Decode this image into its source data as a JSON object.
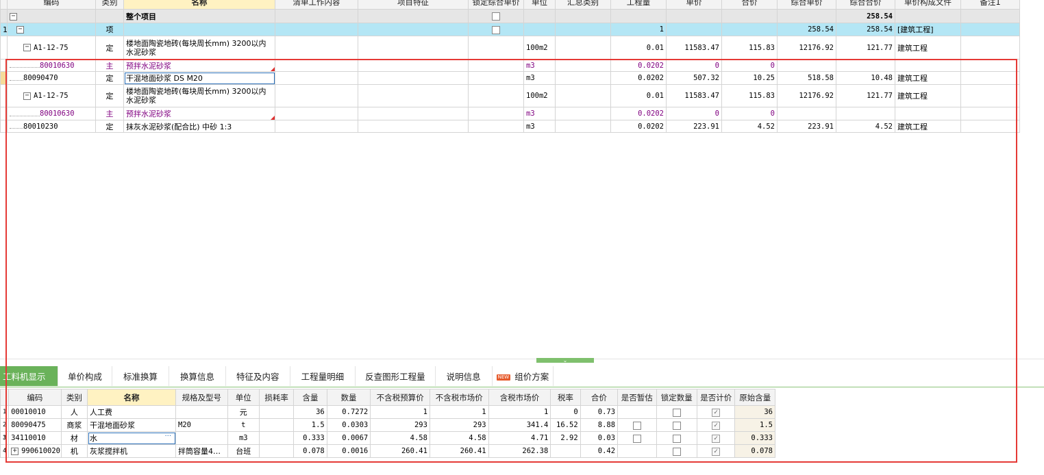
{
  "upper": {
    "headers": [
      "编码",
      "类别",
      "名称",
      "清单工作内容",
      "项目特征",
      "锁定综合单价",
      "单位",
      "汇总类别",
      "工程量",
      "单价",
      "合价",
      "综合单价",
      "综合合价",
      "单价构成文件",
      "备注1"
    ],
    "rows": [
      {
        "rownum": "",
        "code": "",
        "type": "",
        "name": "整个项目",
        "unit": "",
        "qty": "",
        "price": "",
        "amount": "",
        "comp_price": "",
        "comp_total": "258.54",
        "file": ""
      },
      {
        "rownum": "1",
        "code": "",
        "type": "项",
        "name": "",
        "unit": "",
        "qty": "1",
        "price": "",
        "amount": "",
        "comp_price": "258.54",
        "comp_total": "258.54",
        "file": "[建筑工程]"
      },
      {
        "rownum": "",
        "code": "A1-12-75",
        "type": "定",
        "name": "楼地面陶瓷地砖(每块周长mm) 3200以内水泥砂浆",
        "unit": "100m2",
        "qty": "0.01",
        "price": "11583.47",
        "amount": "115.83",
        "comp_price": "12176.92",
        "comp_total": "121.77",
        "file": "建筑工程"
      },
      {
        "rownum": "",
        "code": "80010630",
        "type": "主",
        "name": "预拌水泥砂浆",
        "unit": "m3",
        "qty": "0.0202",
        "price": "0",
        "amount": "0",
        "comp_price": "",
        "comp_total": "",
        "file": ""
      },
      {
        "rownum": "",
        "code": "80090470",
        "type": "定",
        "name": "干混地面砂浆 DS M20",
        "unit": "m3",
        "qty": "0.0202",
        "price": "507.32",
        "amount": "10.25",
        "comp_price": "518.58",
        "comp_total": "10.48",
        "file": "建筑工程"
      },
      {
        "rownum": "",
        "code": "A1-12-75",
        "type": "定",
        "name": "楼地面陶瓷地砖(每块周长mm) 3200以内水泥砂浆",
        "unit": "100m2",
        "qty": "0.01",
        "price": "11583.47",
        "amount": "115.83",
        "comp_price": "12176.92",
        "comp_total": "121.77",
        "file": "建筑工程"
      },
      {
        "rownum": "",
        "code": "80010630",
        "type": "主",
        "name": "预拌水泥砂浆",
        "unit": "m3",
        "qty": "0.0202",
        "price": "0",
        "amount": "0",
        "comp_price": "",
        "comp_total": "",
        "file": ""
      },
      {
        "rownum": "",
        "code": "80010230",
        "type": "定",
        "name": "抹灰水泥砂浆(配合比) 中砂 1:3",
        "unit": "m3",
        "qty": "0.0202",
        "price": "223.91",
        "amount": "4.52",
        "comp_price": "223.91",
        "comp_total": "4.52",
        "file": "建筑工程"
      }
    ]
  },
  "tabs": [
    "工料机显示",
    "单价构成",
    "标准换算",
    "换算信息",
    "特征及内容",
    "工程量明细",
    "反查图形工程量",
    "说明信息",
    "组价方案"
  ],
  "new_badge": "NEW",
  "lower": {
    "headers": [
      "编码",
      "类别",
      "名称",
      "规格及型号",
      "单位",
      "损耗率",
      "含量",
      "数量",
      "不含税预算价",
      "不含税市场价",
      "含税市场价",
      "税率",
      "合价",
      "是否暂估",
      "锁定数量",
      "是否计价",
      "原始含量"
    ],
    "rows": [
      {
        "rownum": "1",
        "code": "00010010",
        "type": "人",
        "name": "人工费",
        "spec": "",
        "unit": "元",
        "loss": "",
        "content": "36",
        "qty": "0.7272",
        "budget": "1",
        "market": "1",
        "tax_market": "1",
        "tax_rate": "0",
        "total": "0.73",
        "orig": "36"
      },
      {
        "rownum": "2",
        "code": "80090475",
        "type": "商浆",
        "name": "干混地面砂浆",
        "spec": "M20",
        "unit": "t",
        "loss": "",
        "content": "1.5",
        "qty": "0.0303",
        "budget": "293",
        "market": "293",
        "tax_market": "341.4",
        "tax_rate": "16.52",
        "total": "8.88",
        "orig": "1.5"
      },
      {
        "rownum": "3",
        "code": "34110010",
        "type": "材",
        "name": "水",
        "spec": "",
        "unit": "m3",
        "loss": "",
        "content": "0.333",
        "qty": "0.0067",
        "budget": "4.58",
        "market": "4.58",
        "tax_market": "4.71",
        "tax_rate": "2.92",
        "total": "0.03",
        "orig": "0.333"
      },
      {
        "rownum": "4",
        "code": "990610020",
        "type": "机",
        "name": "灰浆搅拌机",
        "spec": "拌筒容量4…",
        "unit": "台班",
        "loss": "",
        "content": "0.078",
        "qty": "0.0016",
        "budget": "260.41",
        "market": "260.41",
        "tax_market": "262.38",
        "tax_rate": "",
        "total": "0.42",
        "orig": "0.078"
      }
    ]
  },
  "icons": {
    "collapse": "minus-toggle-icon",
    "expand": "plus-toggle-icon",
    "ellipsis": "···"
  },
  "colors": {
    "accent_green": "#6ab25a",
    "selection_blue": "#b4e6f5",
    "material_purple": "#800080",
    "annotation_red": "#e53935"
  }
}
